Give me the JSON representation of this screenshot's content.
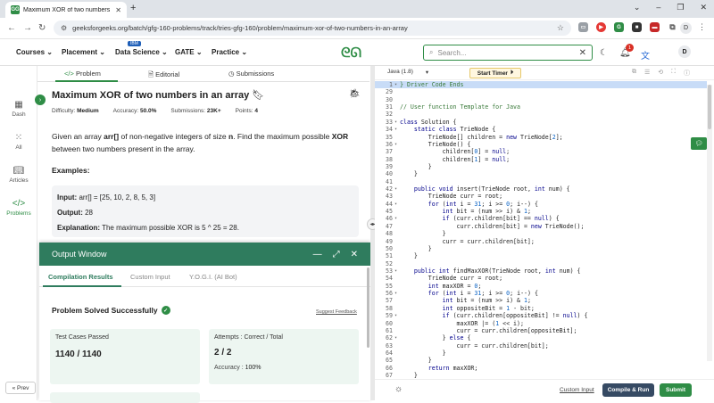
{
  "browser": {
    "tab_title": "Maximum XOR of two numbers in an array",
    "favicon_text": "GG",
    "url": "geeksforgeeks.org/batch/gfg-160-problems/track/tries-gfg-160/problem/maximum-xor-of-two-numbers-in-an-array",
    "profile_initial": "D"
  },
  "nav": {
    "items": [
      "Courses",
      "Placement",
      "Data Science",
      "GATE",
      "Practice"
    ],
    "ibm_badge": "IBM",
    "logo": "GfG",
    "search_placeholder": "Search...",
    "notification_count": "1",
    "user_initial": "D"
  },
  "sidebar": {
    "items": [
      "Dash",
      "All",
      "Articles",
      "Problems"
    ],
    "prev_label": "« Prev"
  },
  "problem": {
    "tabs": [
      "Problem",
      "Editorial",
      "Submissions"
    ],
    "title": "Maximum XOR of two numbers in an array",
    "meta": {
      "difficulty_label": "Difficulty:",
      "difficulty": "Medium",
      "accuracy_label": "Accuracy:",
      "accuracy": "50.0%",
      "submissions_label": "Submissions:",
      "submissions": "23K+",
      "points_label": "Points:",
      "points": "4"
    },
    "desc_1": "Given an array ",
    "desc_arr": "arr[]",
    "desc_2": " of non-negative integers of size ",
    "desc_n": "n",
    "desc_3": ". Find the maximum possible ",
    "desc_xor": "XOR",
    "desc_4": " between two numbers present in the array.",
    "examples_heading": "Examples:",
    "input_label": "Input:",
    "input_value": " arr[] = [25, 10, 2, 8, 5, 3]",
    "output_label": "Output:",
    "output_value": " 28",
    "explanation_label": "Explanation:",
    "explanation_value": " The maximum possible XOR is 5 ^ 25 = 28."
  },
  "output_window": {
    "title": "Output Window",
    "tabs": [
      "Compilation Results",
      "Custom Input",
      "Y.O.G.I. (AI Bot)"
    ],
    "status": "Problem Solved Successfully",
    "suggest_feedback": "Suggest Feedback",
    "test_cases_label": "Test Cases Passed",
    "test_cases_value": "1140 / 1140",
    "attempts_label": "Attempts : Correct / Total",
    "attempts_value": "2 / 2",
    "accuracy_label": "Accuracy : ",
    "accuracy_value": "100%"
  },
  "editor": {
    "language": "Java (1.8)",
    "start_timer": "Start Timer",
    "custom_input": "Custom Input",
    "compile_run": "Compile & Run",
    "submit": "Submit",
    "lines": [
      {
        "n": "1",
        "f": "▾",
        "t": "} Driver Code Ends",
        "hl": true
      },
      {
        "n": "29",
        "f": "",
        "t": ""
      },
      {
        "n": "30",
        "f": "",
        "t": ""
      },
      {
        "n": "31",
        "f": "",
        "t": "// User function Template for Java"
      },
      {
        "n": "32",
        "f": "",
        "t": ""
      },
      {
        "n": "33",
        "f": "▾",
        "t": "class Solution {"
      },
      {
        "n": "34",
        "f": "▾",
        "t": "    static class TrieNode {"
      },
      {
        "n": "35",
        "f": "",
        "t": "        TrieNode[] children = new TrieNode[2];"
      },
      {
        "n": "36",
        "f": "▾",
        "t": "        TrieNode() {"
      },
      {
        "n": "37",
        "f": "",
        "t": "            children[0] = null;"
      },
      {
        "n": "38",
        "f": "",
        "t": "            children[1] = null;"
      },
      {
        "n": "39",
        "f": "",
        "t": "        }"
      },
      {
        "n": "40",
        "f": "",
        "t": "    }"
      },
      {
        "n": "41",
        "f": "",
        "t": ""
      },
      {
        "n": "42",
        "f": "▾",
        "t": "    public void insert(TrieNode root, int num) {"
      },
      {
        "n": "43",
        "f": "",
        "t": "        TrieNode curr = root;"
      },
      {
        "n": "44",
        "f": "▾",
        "t": "        for (int i = 31; i >= 0; i--) {"
      },
      {
        "n": "45",
        "f": "",
        "t": "            int bit = (num >> i) & 1;"
      },
      {
        "n": "46",
        "f": "▾",
        "t": "            if (curr.children[bit] == null) {"
      },
      {
        "n": "47",
        "f": "",
        "t": "                curr.children[bit] = new TrieNode();"
      },
      {
        "n": "48",
        "f": "",
        "t": "            }"
      },
      {
        "n": "49",
        "f": "",
        "t": "            curr = curr.children[bit];"
      },
      {
        "n": "50",
        "f": "",
        "t": "        }"
      },
      {
        "n": "51",
        "f": "",
        "t": "    }"
      },
      {
        "n": "52",
        "f": "",
        "t": ""
      },
      {
        "n": "53",
        "f": "▾",
        "t": "    public int findMaxXOR(TrieNode root, int num) {"
      },
      {
        "n": "54",
        "f": "",
        "t": "        TrieNode curr = root;"
      },
      {
        "n": "55",
        "f": "",
        "t": "        int maxXOR = 0;"
      },
      {
        "n": "56",
        "f": "▾",
        "t": "        for (int i = 31; i >= 0; i--) {"
      },
      {
        "n": "57",
        "f": "",
        "t": "            int bit = (num >> i) & 1;"
      },
      {
        "n": "58",
        "f": "",
        "t": "            int oppositeBit = 1 - bit;"
      },
      {
        "n": "59",
        "f": "▾",
        "t": "            if (curr.children[oppositeBit] != null) {"
      },
      {
        "n": "60",
        "f": "",
        "t": "                maxXOR |= (1 << i);"
      },
      {
        "n": "61",
        "f": "",
        "t": "                curr = curr.children[oppositeBit];"
      },
      {
        "n": "62",
        "f": "▾",
        "t": "            } else {"
      },
      {
        "n": "63",
        "f": "",
        "t": "                curr = curr.children[bit];"
      },
      {
        "n": "64",
        "f": "",
        "t": "            }"
      },
      {
        "n": "65",
        "f": "",
        "t": "        }"
      },
      {
        "n": "66",
        "f": "",
        "t": "        return maxXOR;"
      },
      {
        "n": "67",
        "f": "",
        "t": "    }"
      }
    ]
  },
  "colors": {
    "brand_green": "#2f8d46",
    "output_header": "#2f7c5e",
    "compile_button": "#364a63"
  }
}
